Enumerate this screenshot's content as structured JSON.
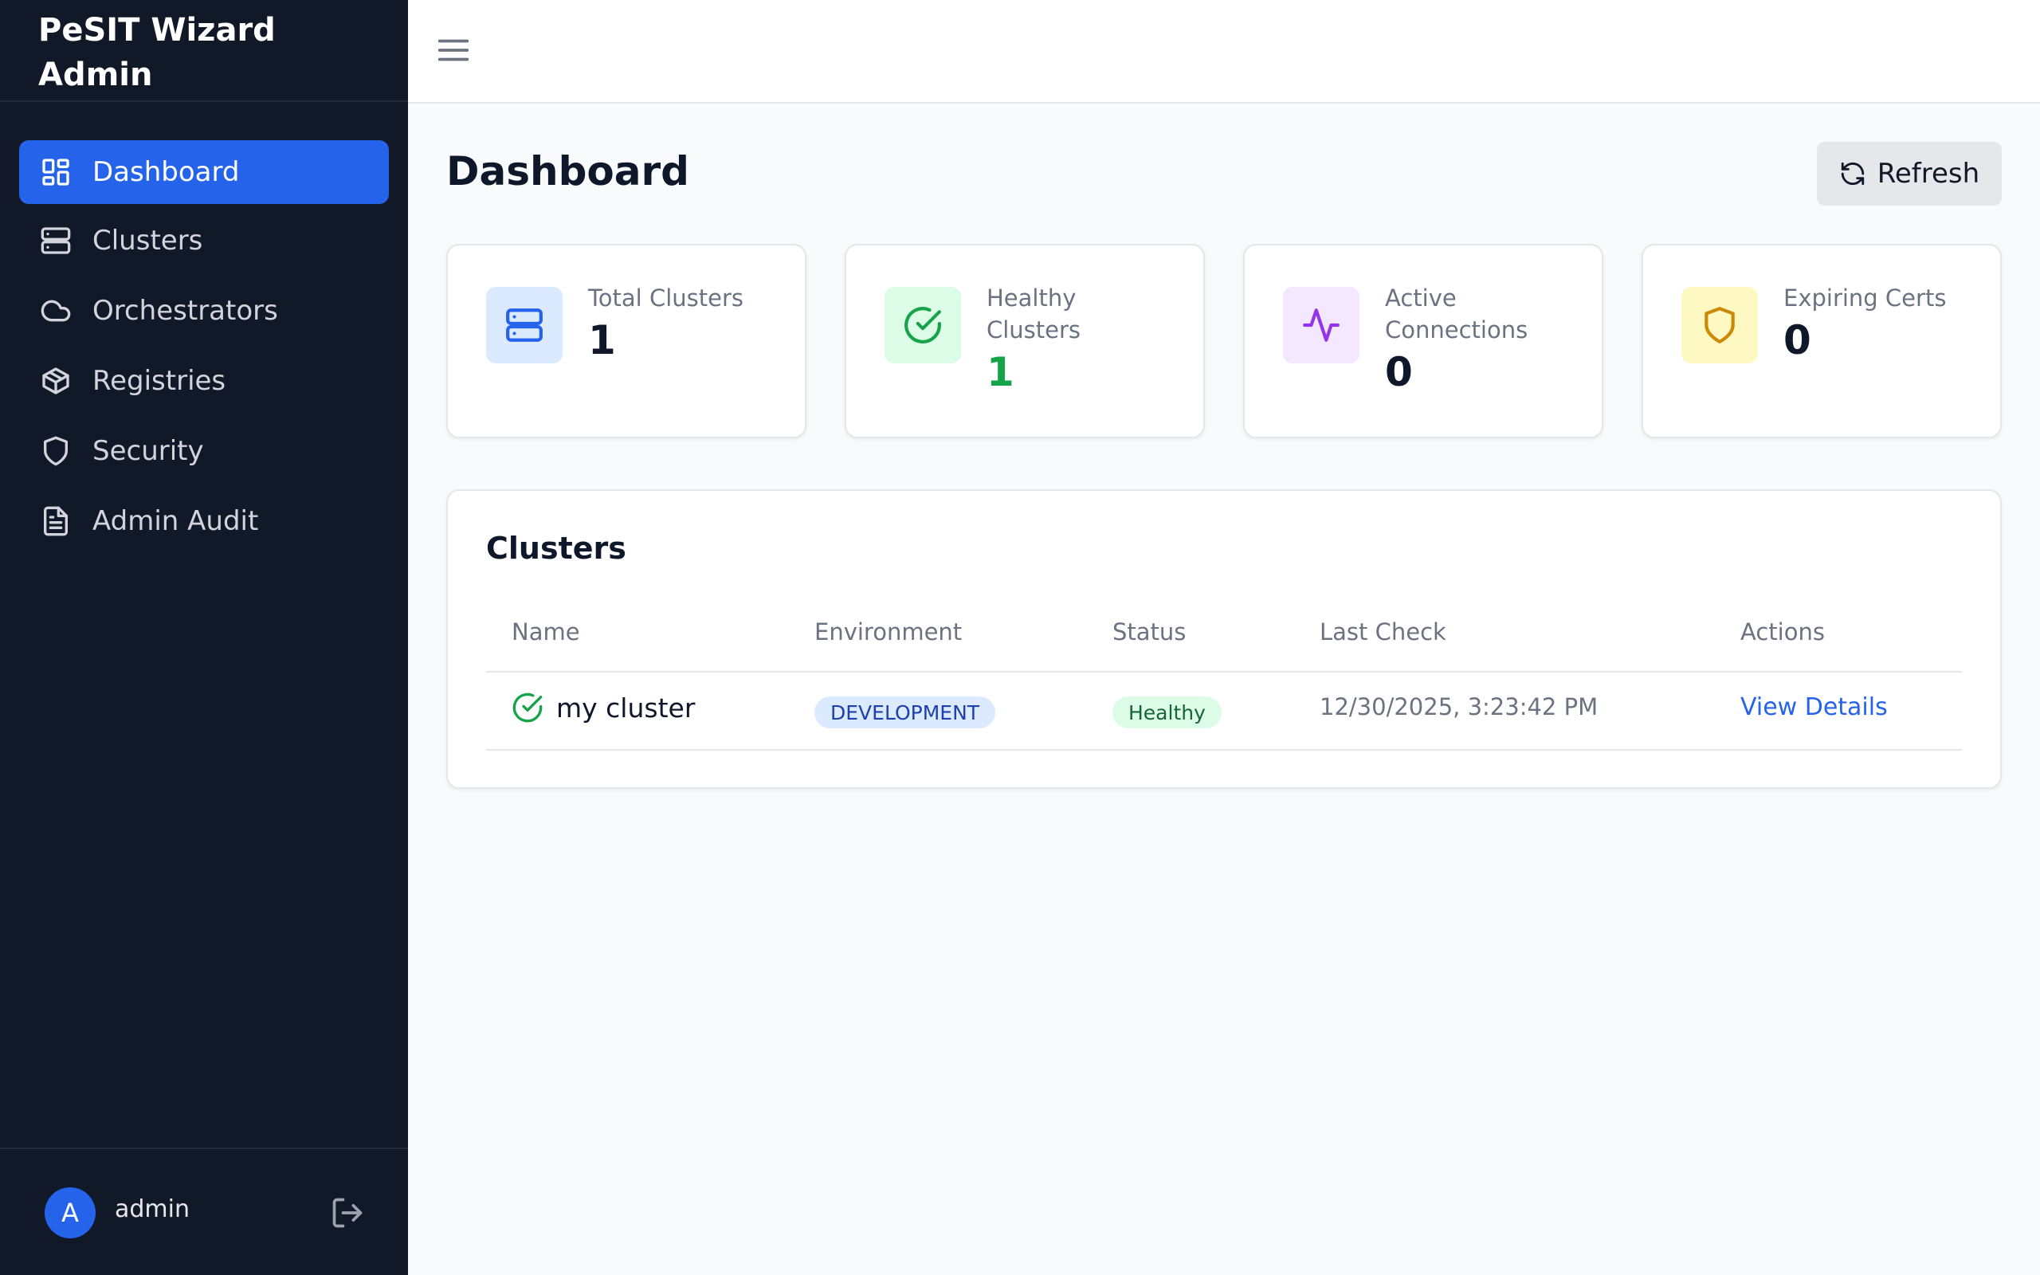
{
  "app": {
    "title": "PeSIT Wizard Admin"
  },
  "sidebar": {
    "items": [
      {
        "label": "Dashboard",
        "icon": "dashboard-grid-icon",
        "active": true
      },
      {
        "label": "Clusters",
        "icon": "server-icon"
      },
      {
        "label": "Orchestrators",
        "icon": "cloud-icon"
      },
      {
        "label": "Registries",
        "icon": "package-icon"
      },
      {
        "label": "Security",
        "icon": "shield-icon"
      },
      {
        "label": "Admin Audit",
        "icon": "document-icon"
      }
    ],
    "user": {
      "initial": "A",
      "name": "admin"
    }
  },
  "header": {
    "menu_icon": "hamburger-menu-icon"
  },
  "page": {
    "title": "Dashboard",
    "refresh_label": "Refresh"
  },
  "stats": [
    {
      "label": "Total Clusters",
      "value": "1",
      "icon": "server-icon",
      "icon_bg": "#dbeafe",
      "icon_color": "#2563eb",
      "value_color": "#0f172a"
    },
    {
      "label": "Healthy Clusters",
      "value": "1",
      "icon": "check-circle-icon",
      "icon_bg": "#dcfce7",
      "icon_color": "#16a34a",
      "value_color": "#16a34a"
    },
    {
      "label": "Active Connections",
      "value": "0",
      "icon": "activity-icon",
      "icon_bg": "#f3e8ff",
      "icon_color": "#9333ea",
      "value_color": "#0f172a"
    },
    {
      "label": "Expiring Certs",
      "value": "0",
      "icon": "shield-icon",
      "icon_bg": "#fef9c3",
      "icon_color": "#ca8a04",
      "value_color": "#0f172a"
    }
  ],
  "clusters": {
    "title": "Clusters",
    "columns": [
      "Name",
      "Environment",
      "Status",
      "Last Check",
      "Actions"
    ],
    "rows": [
      {
        "name": "my cluster",
        "environment": "DEVELOPMENT",
        "status": "Healthy",
        "last_check": "12/30/2025, 3:23:42 PM",
        "action": "View Details"
      }
    ]
  },
  "colors": {
    "sidebar_bg": "#111827",
    "accent": "#2563eb",
    "healthy": "#16a34a"
  }
}
